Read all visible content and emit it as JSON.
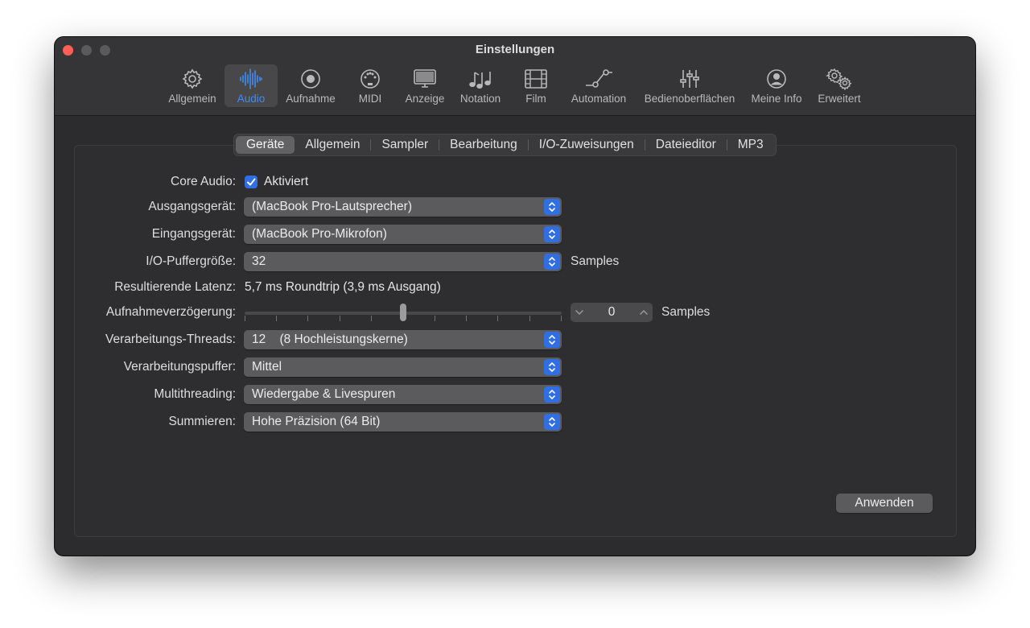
{
  "window": {
    "title": "Einstellungen"
  },
  "toolbar": {
    "items": [
      {
        "label": "Allgemein",
        "icon": "gear-icon"
      },
      {
        "label": "Audio",
        "icon": "waveform-icon",
        "active": true
      },
      {
        "label": "Aufnahme",
        "icon": "record-icon"
      },
      {
        "label": "MIDI",
        "icon": "midi-port-icon"
      },
      {
        "label": "Anzeige",
        "icon": "display-icon"
      },
      {
        "label": "Notation",
        "icon": "music-notes-icon"
      },
      {
        "label": "Film",
        "icon": "film-icon"
      },
      {
        "label": "Automation",
        "icon": "automation-icon"
      },
      {
        "label": "Bedienoberflächen",
        "icon": "sliders-icon"
      },
      {
        "label": "Meine Info",
        "icon": "person-icon"
      },
      {
        "label": "Erweitert",
        "icon": "gears-icon"
      }
    ]
  },
  "tabs": [
    "Geräte",
    "Allgemein",
    "Sampler",
    "Bearbeitung",
    "I/O-Zuweisungen",
    "Dateieditor",
    "MP3"
  ],
  "tabs_active": "Geräte",
  "form": {
    "core_audio": {
      "label": "Core Audio:",
      "checkbox_label": "Aktiviert",
      "checked": true
    },
    "output_device": {
      "label": "Ausgangsgerät:",
      "value": "(MacBook Pro-Lautsprecher)"
    },
    "input_device": {
      "label": "Eingangsgerät:",
      "value": "(MacBook Pro-Mikrofon)"
    },
    "buffer_size": {
      "label": "I/O-Puffergröße:",
      "value": "32",
      "unit": "Samples"
    },
    "latency": {
      "label": "Resultierende Latenz:",
      "value": "5,7 ms Roundtrip (3,9 ms Ausgang)"
    },
    "record_delay": {
      "label": "Aufnahmeverzögerung:",
      "value": "0",
      "unit": "Samples",
      "slider_fraction": 0.5
    },
    "threads": {
      "label": "Verarbeitungs-Threads:",
      "value": "12    (8 Hochleistungskerne)"
    },
    "process_buffer": {
      "label": "Verarbeitungspuffer:",
      "value": "Mittel"
    },
    "multithreading": {
      "label": "Multithreading:",
      "value": "Wiedergabe & Livespuren"
    },
    "summing": {
      "label": "Summieren:",
      "value": "Hohe Präzision (64 Bit)"
    }
  },
  "apply_button": "Anwenden",
  "colors": {
    "accent": "#2f6fe3",
    "active_tool": "#3f8cf5",
    "window_bg": "#2c2c2e",
    "close": "#fe5f57"
  }
}
